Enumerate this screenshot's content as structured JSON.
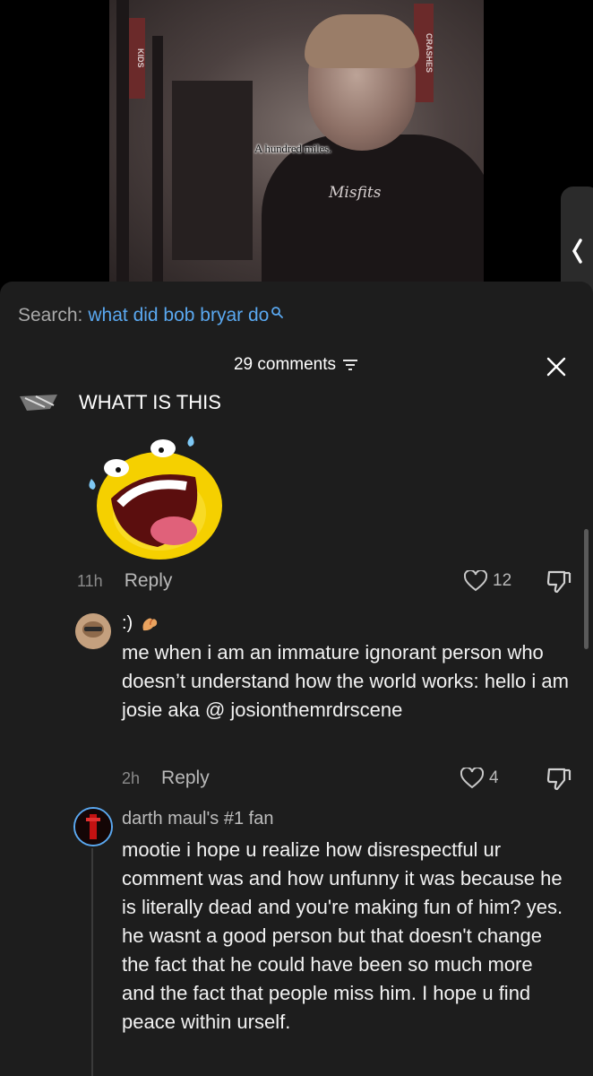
{
  "video": {
    "caption": "A hundred miles.",
    "shirt_text": "Misfits",
    "banner_left": "KIDS",
    "banner_right": "CRASHES"
  },
  "search": {
    "prefix": "Search:",
    "query": "what did bob bryar do"
  },
  "comments": {
    "count_label": "29 comments"
  },
  "comment1": {
    "text": "WHATT IS THIS",
    "time": "11h",
    "reply": "Reply",
    "likes": "12"
  },
  "reply1": {
    "username": ":)",
    "body": "me when i am an immature ignorant person who doesn’t understand how the world works: hello i am josie aka @ josionthemrdrscene",
    "time": "2h",
    "reply": "Reply",
    "likes": "4"
  },
  "reply2": {
    "username": "darth maul's #1 fan",
    "body": "mootie i hope u realize how disrespectful ur comment was and how unfunny it was because he is literally dead and you're making fun of him? yes. he wasnt a good person but that doesn't change the fact that he could have been so much more and the fact that people miss him. I hope u find peace within urself."
  },
  "colors": {
    "sheet_bg": "#1d1d1d",
    "link_blue": "#5aa8f0",
    "muted": "#8b8b8b"
  },
  "icons": [
    "search-icon",
    "filter-icon",
    "close-icon",
    "heart-icon",
    "dislike-icon",
    "chevron-left-icon"
  ]
}
